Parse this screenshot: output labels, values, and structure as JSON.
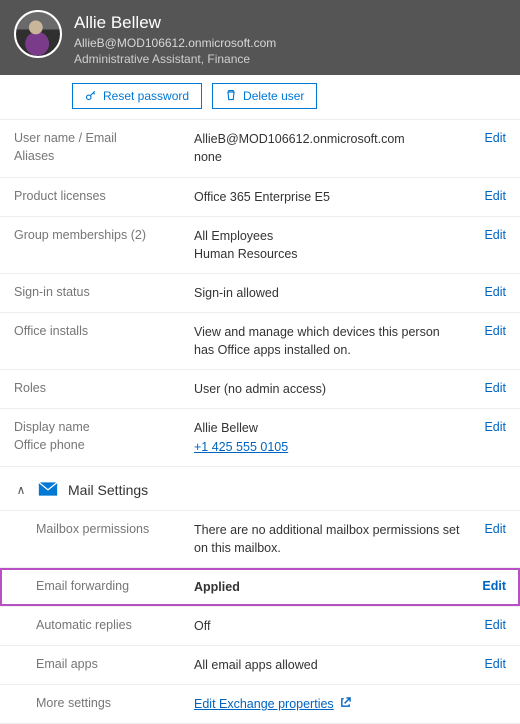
{
  "header": {
    "name": "Allie Bellew",
    "email": "AllieB@MOD106612.onmicrosoft.com",
    "role": "Administrative Assistant, Finance"
  },
  "toolbar": {
    "reset_password": "Reset password",
    "delete_user": "Delete user"
  },
  "labels": {
    "username_email": "User name / Email",
    "aliases": "Aliases",
    "product_licenses": "Product licenses",
    "group_memberships": "Group memberships (2)",
    "signin_status": "Sign-in status",
    "office_installs": "Office installs",
    "roles": "Roles",
    "display_name": "Display name",
    "office_phone": "Office phone",
    "mail_section": "Mail Settings",
    "mailbox_permissions": "Mailbox permissions",
    "email_forwarding": "Email forwarding",
    "automatic_replies": "Automatic replies",
    "email_apps": "Email apps",
    "more_settings": "More settings",
    "edit": "Edit"
  },
  "values": {
    "username_email": "AllieB@MOD106612.onmicrosoft.com",
    "aliases": "none",
    "product_licenses": "Office 365 Enterprise E5",
    "groups_line1": "All Employees",
    "groups_line2": "Human Resources",
    "signin_status": "Sign-in allowed",
    "office_installs": "View and manage which devices this person has Office apps installed on.",
    "roles": "User (no admin access)",
    "display_name": "Allie Bellew",
    "office_phone": "+1 425 555 0105",
    "mailbox_permissions": "There are no additional mailbox permissions set on this mailbox.",
    "email_forwarding": "Applied",
    "automatic_replies": "Off",
    "email_apps": "All email apps allowed",
    "more_settings_link": "Edit Exchange properties"
  }
}
